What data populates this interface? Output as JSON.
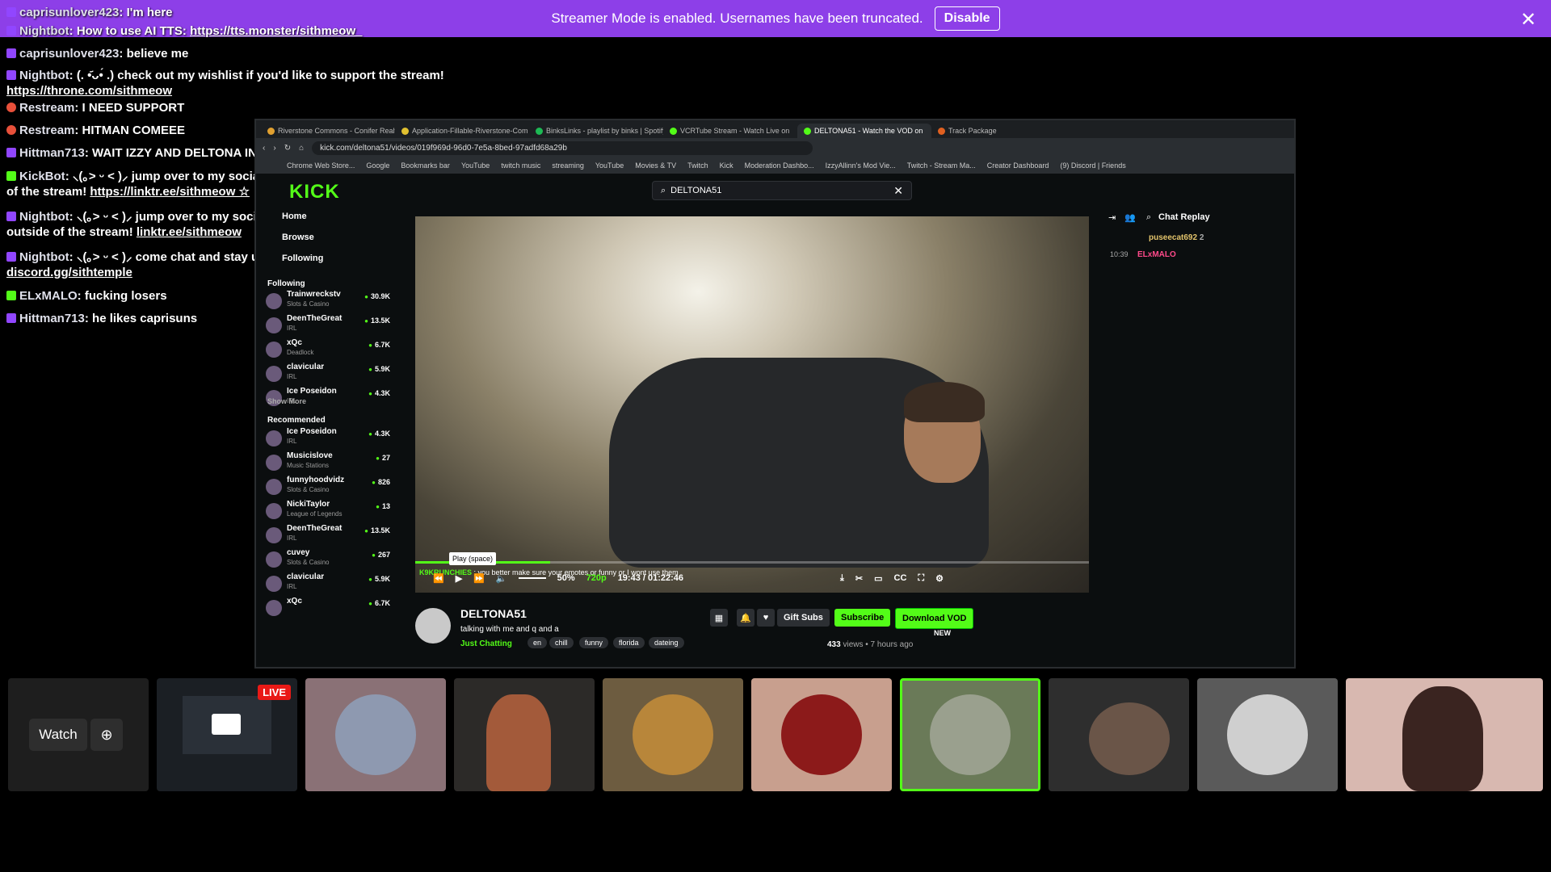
{
  "banner": {
    "text": "Streamer Mode is enabled. Usernames have been truncated.",
    "button": "Disable",
    "close": "✕"
  },
  "overlay_chat": [
    {
      "badge": "twitch",
      "user": "caprisunlover423",
      "text": "I'm here",
      "link": ""
    },
    {
      "badge": "twitch",
      "user": "Nightbot",
      "text": "How to use AI TTS:",
      "link": "https://tts.monster/sithmeow_"
    },
    {
      "badge": "twitch",
      "user": "caprisunlover423",
      "text": "believe me",
      "link": ""
    },
    {
      "badge": "twitch",
      "user": "Nightbot",
      "text": "(. •᷄ᴗ•́ .) check out my wishlist if you'd like to support the stream!",
      "link": "https://throne.com/sithmeow"
    },
    {
      "badge": "restream",
      "user": "Restream",
      "text": "I NEED SUPPORT",
      "link": ""
    },
    {
      "badge": "restream",
      "user": "Restream",
      "text": "HITMAN COMEEE",
      "link": ""
    },
    {
      "badge": "twitch",
      "user": "Hittman713",
      "text": "WAIT IZZY AND DELTONA IN VC",
      "link": ""
    },
    {
      "badge": "kick",
      "user": "KickBot",
      "text": "⸜(｡˃ ᵕ ˂ )⸝ jump over to my socials to keep up with everything outside of the stream!",
      "link": "https://linktr.ee/sithmeow ☆"
    },
    {
      "badge": "twitch",
      "user": "Nightbot",
      "text": "⸜(｡˃ ᵕ ˂ )⸝ jump over to my socials to keep up with everything outside of the stream!",
      "link": "linktr.ee/sithmeow"
    },
    {
      "badge": "twitch",
      "user": "Nightbot",
      "text": "⸜(｡˃ ᵕ ˂ )⸝ come chat and stay updated! join the discord here:",
      "link": "discord.gg/sithtemple"
    },
    {
      "badge": "kick",
      "user": "ELxMALO",
      "text": "fucking losers",
      "link": ""
    },
    {
      "badge": "twitch",
      "user": "Hittman713",
      "text": "he likes caprisuns",
      "link": ""
    }
  ],
  "browser": {
    "tabs": [
      {
        "label": "Riverstone Commons - Conifer Realty",
        "color": "#e0a030",
        "active": false
      },
      {
        "label": "Application-Fillable-Riverstone-Com",
        "color": "#e0c030",
        "active": false
      },
      {
        "label": "BinksLinks - playlist by binks | Spotify",
        "color": "#1db954",
        "active": false
      },
      {
        "label": "VCRTube Stream - Watch Live on",
        "color": "#53fc18",
        "active": false
      },
      {
        "label": "DELTONA51 - Watch the VOD on",
        "color": "#53fc18",
        "active": true
      },
      {
        "label": "Track Package",
        "color": "#e06020",
        "active": false
      }
    ],
    "url": "kick.com/deltona51/videos/019f969d-96d0-7e5a-8bed-97adfd68a29b",
    "bookmarks": [
      "Chrome Web Store...",
      "Google",
      "Bookmarks bar",
      "YouTube",
      "twitch music",
      "streaming",
      "YouTube",
      "Movies & TV",
      "Twitch",
      "Kick",
      "Moderation Dashbo...",
      "IzzyAllinn's Mod Vie...",
      "Twitch - Stream Ma...",
      "Creator Dashboard",
      "(9) Discord | Friends"
    ]
  },
  "kick": {
    "logo": "KICK",
    "search_value": "DELTONA51",
    "nav": [
      "Home",
      "Browse",
      "Following"
    ],
    "following_title": "Following",
    "following": [
      {
        "name": "Trainwreckstv",
        "cat": "Slots & Casino",
        "viewers": "30.9K"
      },
      {
        "name": "DeenTheGreat",
        "cat": "IRL",
        "viewers": "13.5K"
      },
      {
        "name": "xQc",
        "cat": "Deadlock",
        "viewers": "6.7K"
      },
      {
        "name": "clavicular",
        "cat": "IRL",
        "viewers": "5.9K"
      },
      {
        "name": "Ice Poseidon",
        "cat": "IRL",
        "viewers": "4.3K"
      }
    ],
    "show_more": "Show More",
    "recommended_title": "Recommended",
    "recommended": [
      {
        "name": "Ice Poseidon",
        "cat": "IRL",
        "viewers": "4.3K"
      },
      {
        "name": "Musicislove",
        "cat": "Music Stations",
        "viewers": "27"
      },
      {
        "name": "funnyhoodvidz",
        "cat": "Slots & Casino",
        "viewers": "826"
      },
      {
        "name": "NickiTaylor",
        "cat": "League of Legends",
        "viewers": "13"
      },
      {
        "name": "DeenTheGreat",
        "cat": "IRL",
        "viewers": "13.5K"
      },
      {
        "name": "cuvey",
        "cat": "Slots & Casino",
        "viewers": "267"
      },
      {
        "name": "clavicular",
        "cat": "IRL",
        "viewers": "5.9K"
      },
      {
        "name": "xQc",
        "cat": "",
        "viewers": "6.7K"
      }
    ],
    "player": {
      "chat_user": "K9KRUNCHIES",
      "chat_text": ": you better make sure your emotes or funny or I wont use them",
      "tooltip": "Play (space)",
      "volume": "50%",
      "quality": "720p",
      "time": "19:43 / 01:22:46",
      "progress": 0.2
    },
    "stream": {
      "name": "DELTONA51",
      "title": "talking with me and q and a",
      "category": "Just Chatting",
      "tags": [
        "en",
        "chill",
        "funny",
        "florida",
        "dateing"
      ],
      "gift": "Gift Subs",
      "subscribe": "Subscribe",
      "download": "Download VOD",
      "new": "NEW",
      "views": "433",
      "views_label": "views",
      "age": "7 hours ago"
    },
    "replay": {
      "title": "Chat Replay",
      "pinned_user": "puseecat692",
      "pinned_count": "2",
      "time": "10:39",
      "user": "ELxMALO"
    }
  },
  "tiles": {
    "watch": "Watch",
    "live": "LIVE"
  }
}
